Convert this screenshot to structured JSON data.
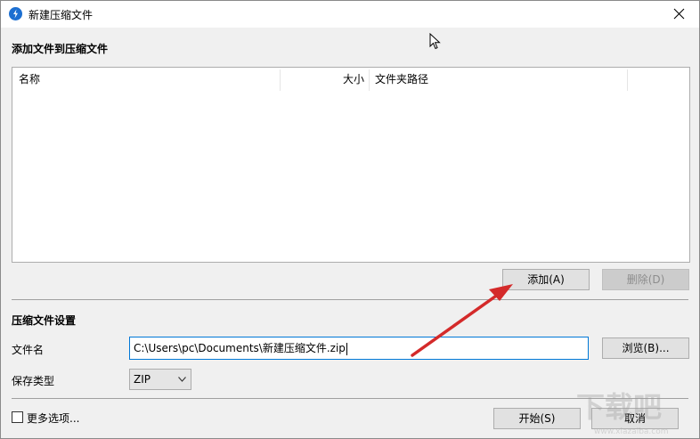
{
  "window": {
    "title": "新建压缩文件",
    "icon": "app-logo-icon",
    "close_icon": "close-icon"
  },
  "add_section": {
    "title": "添加文件到压缩文件",
    "columns": [
      "名称",
      "大小",
      "文件夹路径"
    ],
    "rows": [],
    "add_button": "添加(A)",
    "delete_button": "删除(D)"
  },
  "settings": {
    "title": "压缩文件设置",
    "filename_label": "文件名",
    "filename_value": "C:\\Users\\pc\\Documents\\新建压缩文件.zip",
    "browse_button": "浏览(B)...",
    "save_type_label": "保存类型",
    "save_type_value": "ZIP"
  },
  "footer": {
    "more_options_label": "更多选项...",
    "more_options_checked": false,
    "start_button": "开始(S)",
    "cancel_button": "取消"
  },
  "annotation": {
    "arrow_color": "#d42a2a"
  },
  "watermark": {
    "text": "下载吧",
    "url": "www.xiazaiba.com"
  }
}
